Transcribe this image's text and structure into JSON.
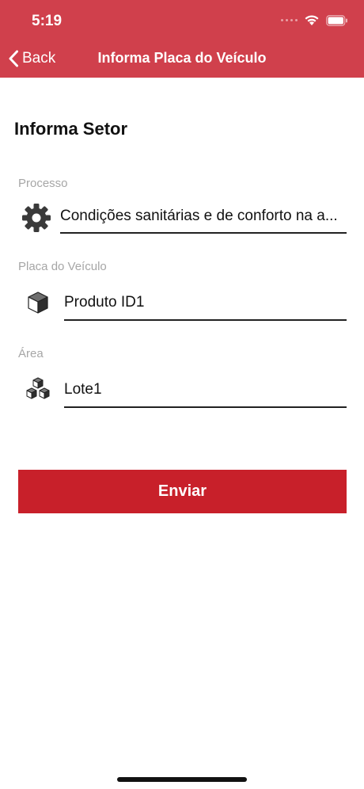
{
  "status_bar": {
    "time": "5:19"
  },
  "nav": {
    "back_label": "Back",
    "title": "Informa Placa do Veículo"
  },
  "form": {
    "section_title": "Informa Setor",
    "fields": [
      {
        "label": "Processo",
        "value": "Condições sanitárias e de conforto na a...",
        "icon": "gear-icon"
      },
      {
        "label": "Placa do Veículo",
        "value": "Produto ID1",
        "icon": "cube-icon"
      },
      {
        "label": "Área",
        "value": "Lote1",
        "icon": "cubes-icon"
      }
    ],
    "submit_label": "Enviar"
  },
  "colors": {
    "header": "#d0404c",
    "button": "#c8202a"
  }
}
